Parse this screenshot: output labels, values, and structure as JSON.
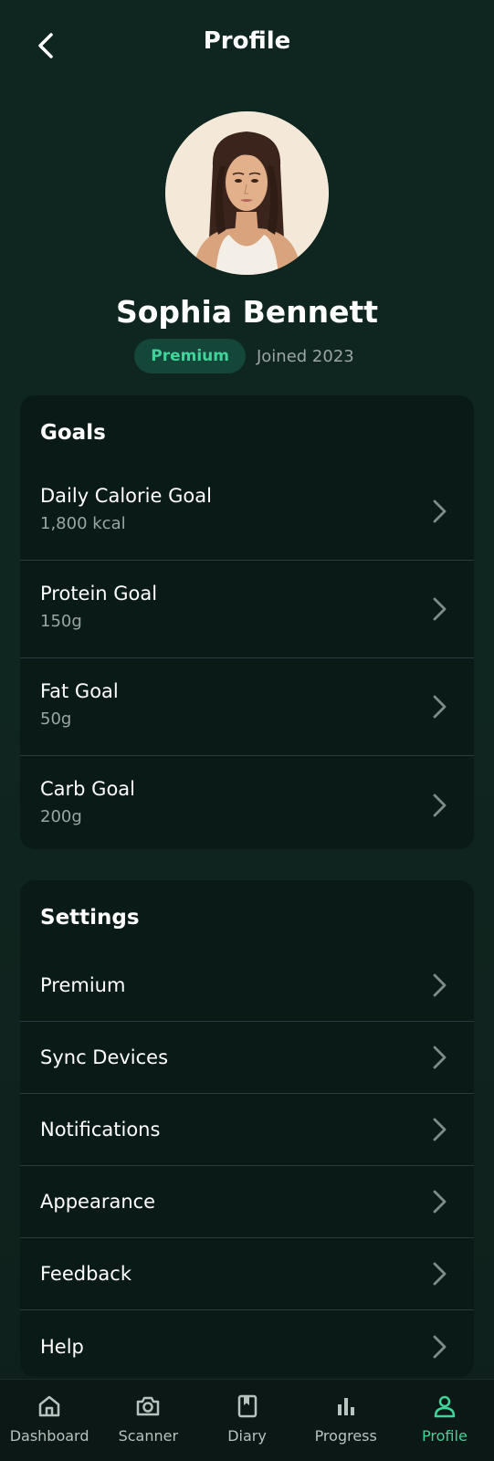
{
  "header": {
    "title": "Profile",
    "back_icon": "chevron-left-icon"
  },
  "profile": {
    "name": "Sophia Bennett",
    "badge": "Premium",
    "joined": "Joined 2023",
    "avatar_icon": "user-avatar-illustration"
  },
  "goals": {
    "title": "Goals",
    "items": [
      {
        "label": "Daily Calorie Goal",
        "value": "1,800 kcal"
      },
      {
        "label": "Protein Goal",
        "value": "150g"
      },
      {
        "label": "Fat Goal",
        "value": "50g"
      },
      {
        "label": "Carb Goal",
        "value": "200g"
      }
    ]
  },
  "settings": {
    "title": "Settings",
    "items": [
      {
        "label": "Premium"
      },
      {
        "label": "Sync Devices"
      },
      {
        "label": "Notifications"
      },
      {
        "label": "Appearance"
      },
      {
        "label": "Feedback"
      },
      {
        "label": "Help"
      }
    ]
  },
  "nav": {
    "items": [
      {
        "label": "Dashboard",
        "icon": "home-icon"
      },
      {
        "label": "Scanner",
        "icon": "camera-icon"
      },
      {
        "label": "Diary",
        "icon": "book-icon"
      },
      {
        "label": "Progress",
        "icon": "bar-chart-icon"
      },
      {
        "label": "Profile",
        "icon": "user-icon",
        "active": true
      }
    ]
  },
  "colors": {
    "accent": "#3fd49a",
    "background": "#0f2520",
    "card": "#0a1a17",
    "badge_bg": "#14473a",
    "muted_text": "#9ba6a3"
  }
}
